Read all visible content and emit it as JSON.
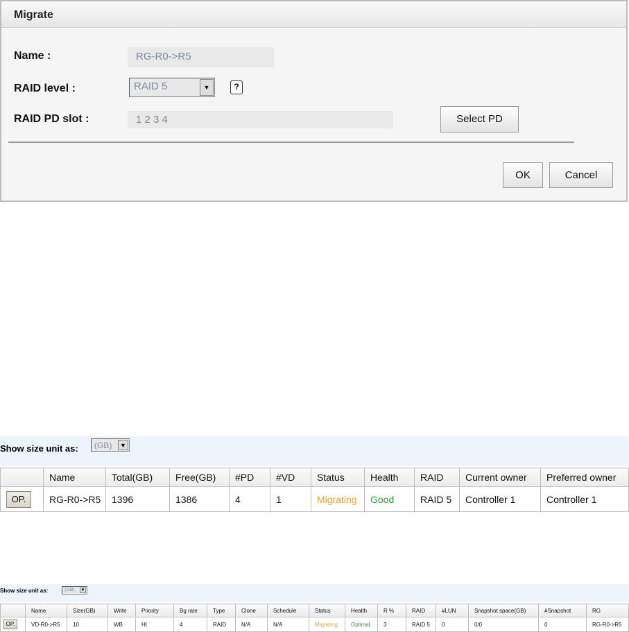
{
  "dialog": {
    "title": "Migrate",
    "name_label": "Name :",
    "name_value": "RG-R0->R5",
    "raid_label": "RAID level :",
    "raid_value": "RAID 5",
    "pd_label": "RAID PD slot :",
    "pd_value": "1 2 3 4",
    "select_pd": "Select PD",
    "ok": "OK",
    "cancel": "Cancel"
  },
  "rg": {
    "unit_label": "Show size unit as:",
    "unit_value": "(GB)",
    "op": "OP.",
    "headers": [
      "",
      "Name",
      "Total(GB)",
      "Free(GB)",
      "#PD",
      "#VD",
      "Status",
      "Health",
      "RAID",
      "Current owner",
      "Preferred owner"
    ],
    "row": [
      "RG-R0->R5",
      "1396",
      "1386",
      "4",
      "1",
      "Migrating",
      "Good",
      "RAID 5",
      "Controller 1",
      "Controller 1"
    ]
  },
  "vd": {
    "unit_label": "Show size unit as:",
    "unit_value": "(GB)",
    "op": "OP.",
    "headers": [
      "",
      "Name",
      "Size(GB)",
      "Write",
      "Priority",
      "Bg rate",
      "Type",
      "Clone",
      "Schedule",
      "Status",
      "Health",
      "R %",
      "RAID",
      "#LUN",
      "Snapshot space(GB)",
      "#Snapshot",
      "RG"
    ],
    "row": [
      "VD-R0->R5",
      "10",
      "WB",
      "HI",
      "4",
      "RAID",
      "N/A",
      "N/A",
      "Migrating",
      "Optimal",
      "3",
      "RAID 5",
      "0",
      "0/0",
      "0",
      "RG-R0->R5"
    ]
  },
  "colors": {
    "migrating": "#f4a020",
    "good": "#2f9a2f"
  }
}
